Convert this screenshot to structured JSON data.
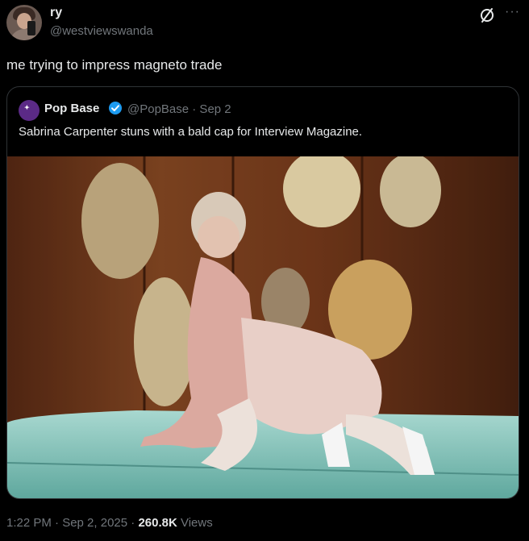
{
  "author": {
    "display_name": "ry",
    "handle": "@westviewswanda",
    "avatar_icon": "profile-photo"
  },
  "tweet": {
    "text": "me trying to impress magneto trade"
  },
  "quoted_tweet": {
    "display_name": "Pop Base",
    "handle_date": "@PopBase · Sep 2",
    "verified_icon": "verified-badge",
    "verified_color": "#1d9bf0",
    "text": "Sabrina Carpenter stuns with a bald cap for Interview Magazine.",
    "image_icon": "photo"
  },
  "footer": {
    "timestamp": "1:22 PM · Sep 2, 2025 · ",
    "views_count": "260.8K",
    "views_label": " Views"
  },
  "colors": {
    "background": "#000000",
    "text_primary": "#e7e9ea",
    "text_secondary": "#71767b",
    "border": "#2f3336"
  }
}
